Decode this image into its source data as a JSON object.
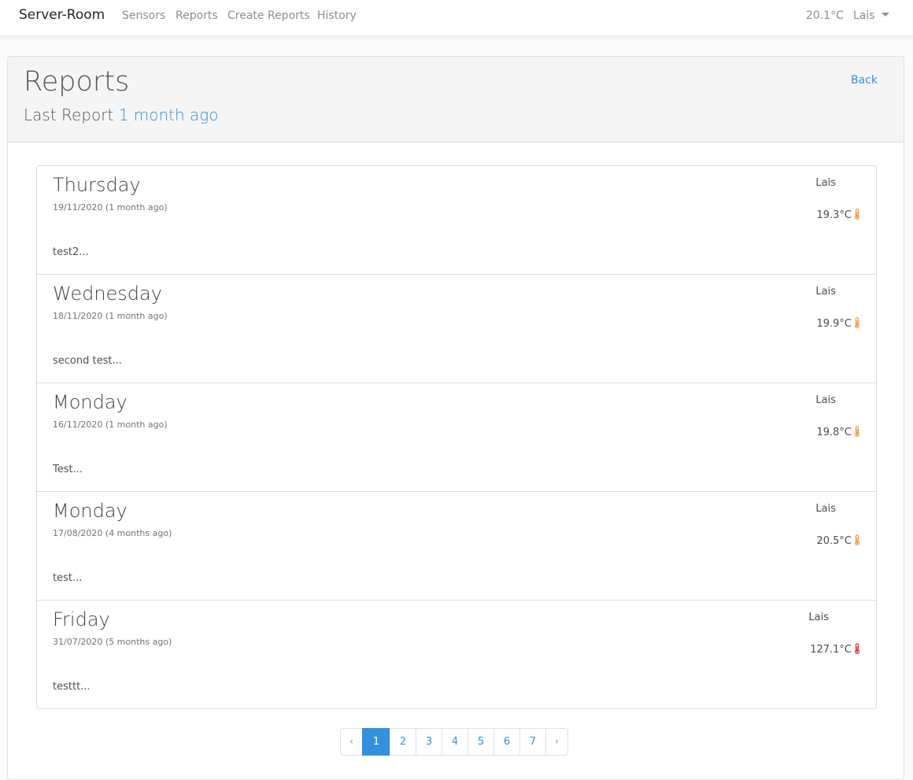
{
  "navbar": {
    "brand": "Server-Room",
    "links": [
      "Sensors",
      "Reports",
      "Create Reports",
      "History"
    ],
    "temperature": "20.1°C",
    "user": "Lais"
  },
  "header": {
    "title": "Reports",
    "subtitle_prefix": "Last Report",
    "subtitle_link": "1 month ago",
    "back_label": "Back"
  },
  "reports": [
    {
      "day": "Thursday",
      "date": "19/11/2020 (1 month ago)",
      "excerpt": "test2...",
      "author": "Lais",
      "temperature": "19.3°C",
      "temp_level": "warm"
    },
    {
      "day": "Wednesday",
      "date": "18/11/2020 (1 month ago)",
      "excerpt": "second test...",
      "author": "Lais",
      "temperature": "19.9°C",
      "temp_level": "warm"
    },
    {
      "day": "Monday",
      "date": "16/11/2020 (1 month ago)",
      "excerpt": "Test...",
      "author": "Lais",
      "temperature": "19.8°C",
      "temp_level": "warm"
    },
    {
      "day": "Monday",
      "date": "17/08/2020 (4 months ago)",
      "excerpt": "test...",
      "author": "Lais",
      "temperature": "20.5°C",
      "temp_level": "warm"
    },
    {
      "day": "Friday",
      "date": "31/07/2020 (5 months ago)",
      "excerpt": "testtt...",
      "author": "Lais",
      "temperature": "127.1°C",
      "temp_level": "hot"
    }
  ],
  "pagination": {
    "prev": "‹",
    "pages": [
      "1",
      "2",
      "3",
      "4",
      "5",
      "6",
      "7"
    ],
    "next": "›",
    "active": "1"
  },
  "colors": {
    "accent": "#3490dc",
    "thermo_warm": "#f6993f",
    "thermo_hot": "#e3342f"
  }
}
